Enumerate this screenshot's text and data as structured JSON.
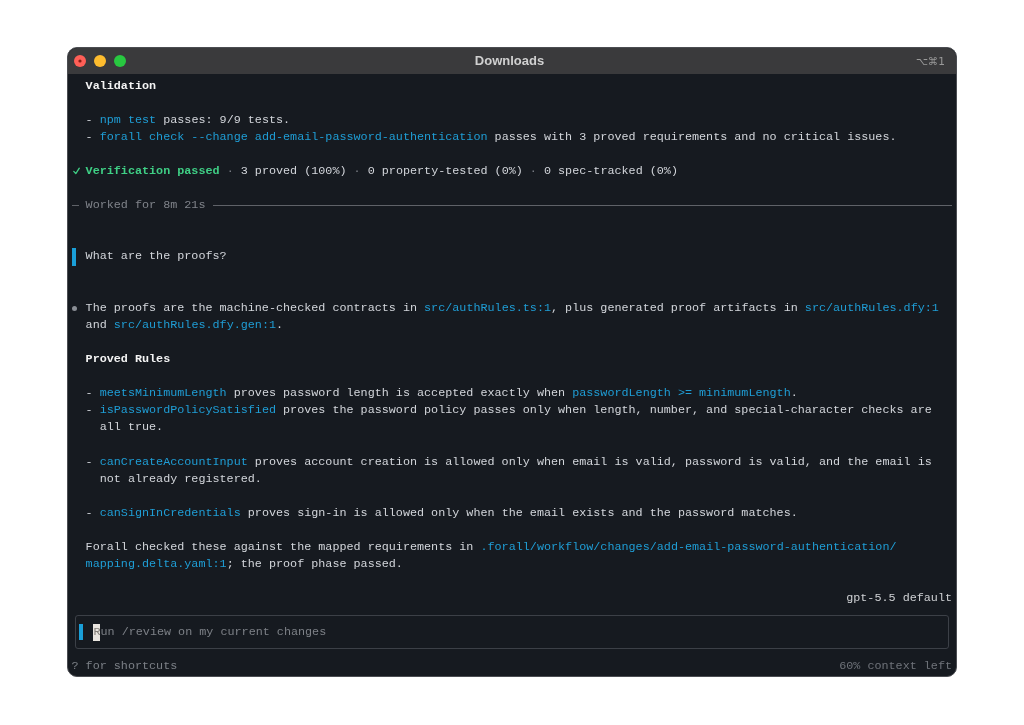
{
  "window": {
    "title": "Downloads",
    "shortcut": "⌥⌘1"
  },
  "transcript": [
    {
      "kind": "heading",
      "text": "Validation"
    },
    {
      "kind": "list",
      "items": [
        [
          {
            "kind": "plain",
            "text": "- "
          },
          {
            "kind": "code",
            "text": "npm test"
          },
          {
            "kind": "plain",
            "text": " passes: 9/9 tests."
          }
        ],
        [
          {
            "kind": "plain",
            "text": "- "
          },
          {
            "kind": "code",
            "text": "forall check --change add-email-password-authentication"
          },
          {
            "kind": "plain",
            "text": " passes with 3 proved requirements and no critical issues."
          }
        ]
      ]
    },
    {
      "kind": "status",
      "passed": true,
      "segments": [
        {
          "kind": "success",
          "text": "Verification passed"
        },
        {
          "kind": "dim",
          "text": " · "
        },
        {
          "kind": "plain",
          "text": "3 proved (100%)"
        },
        {
          "kind": "dim",
          "text": " · "
        },
        {
          "kind": "plain",
          "text": "0 property-tested (0%)"
        },
        {
          "kind": "dim",
          "text": " · "
        },
        {
          "kind": "plain",
          "text": "0 spec-tracked (0%)"
        }
      ]
    },
    {
      "kind": "separator",
      "text": "Worked for 8m 21s"
    },
    {
      "kind": "user_message",
      "text": "What are the proofs?"
    },
    {
      "kind": "assistant_message",
      "blocks": [
        {
          "kind": "paragraph",
          "segments": [
            {
              "kind": "plain",
              "text": "The proofs are the machine-checked contracts in "
            },
            {
              "kind": "code",
              "text": "src/authRules.ts:1"
            },
            {
              "kind": "plain",
              "text": ", plus generated proof artifacts in "
            },
            {
              "kind": "code",
              "text": "src/authRules.dfy:1"
            },
            {
              "kind": "plain",
              "text": " and "
            },
            {
              "kind": "code",
              "text": "src/authRules.dfy.gen:1"
            },
            {
              "kind": "plain",
              "text": "."
            }
          ]
        },
        {
          "kind": "heading",
          "text": "Proved Rules"
        },
        {
          "kind": "list",
          "items": [
            [
              {
                "kind": "plain",
                "text": "- "
              },
              {
                "kind": "code",
                "text": "meetsMinimumLength"
              },
              {
                "kind": "plain",
                "text": " proves password length is accepted exactly when "
              },
              {
                "kind": "code",
                "text": "passwordLength >= minimumLength"
              },
              {
                "kind": "plain",
                "text": "."
              }
            ],
            [
              {
                "kind": "plain",
                "text": "- "
              },
              {
                "kind": "code",
                "text": "isPasswordPolicySatisfied"
              },
              {
                "kind": "plain",
                "text": " proves the password policy passes only when length, number, and special-character checks are all true."
              }
            ]
          ]
        },
        {
          "kind": "list",
          "items": [
            [
              {
                "kind": "plain",
                "text": "- "
              },
              {
                "kind": "code",
                "text": "canCreateAccountInput"
              },
              {
                "kind": "plain",
                "text": " proves account creation is allowed only when email is valid, password is valid, and the email is not already registered."
              }
            ]
          ]
        },
        {
          "kind": "list",
          "items": [
            [
              {
                "kind": "plain",
                "text": "- "
              },
              {
                "kind": "code",
                "text": "canSignInCredentials"
              },
              {
                "kind": "plain",
                "text": " proves sign-in is allowed only when the email exists and the password matches."
              }
            ]
          ]
        },
        {
          "kind": "paragraph",
          "segments": [
            {
              "kind": "plain",
              "text": "Forall checked these against the mapped requirements in "
            },
            {
              "kind": "code",
              "text": ".forall/workflow/changes/add-email-password-authentication/mapping.delta.yaml:1"
            },
            {
              "kind": "plain",
              "text": "; the proof phase passed."
            }
          ]
        }
      ]
    }
  ],
  "composer": {
    "model": "gpt-5.5 default",
    "placeholder": "Run /review on my current changes",
    "focused": true,
    "hint": "? for shortcuts",
    "context": "60% context left"
  }
}
